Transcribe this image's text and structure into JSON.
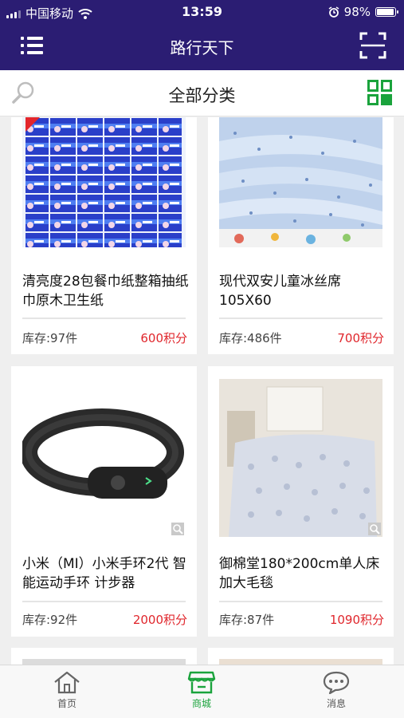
{
  "status_bar": {
    "carrier": "中国移动",
    "time": "13:59",
    "battery": "98%",
    "battery_level": 0.98
  },
  "nav": {
    "title": "路行天下",
    "menu_icon": "menu-icon",
    "scan_icon": "scan-icon"
  },
  "subheader": {
    "title": "全部分类",
    "search_icon": "search-icon",
    "grid_icon": "grid-view-icon"
  },
  "products": [
    {
      "name": "清亮度28包餐巾纸整箱抽纸巾原木卫生纸",
      "stock": "库存:97件",
      "price": "600积分"
    },
    {
      "name": "现代双安儿童冰丝席105X60",
      "stock": "库存:486件",
      "price": "700积分"
    },
    {
      "name": "小米（MI）小米手环2代 智能运动手环 计步器",
      "stock": "库存:92件",
      "price": "2000积分"
    },
    {
      "name": "御棉堂180*200cm单人床加大毛毯",
      "stock": "库存:87件",
      "price": "1090积分"
    }
  ],
  "tabs": [
    {
      "label": "首页",
      "icon": "home-icon"
    },
    {
      "label": "商城",
      "icon": "store-icon"
    },
    {
      "label": "消息",
      "icon": "message-icon"
    }
  ],
  "colors": {
    "nav_bg": "#2b1d73",
    "accent_green": "#1aa33c",
    "price_red": "#e0262c"
  }
}
